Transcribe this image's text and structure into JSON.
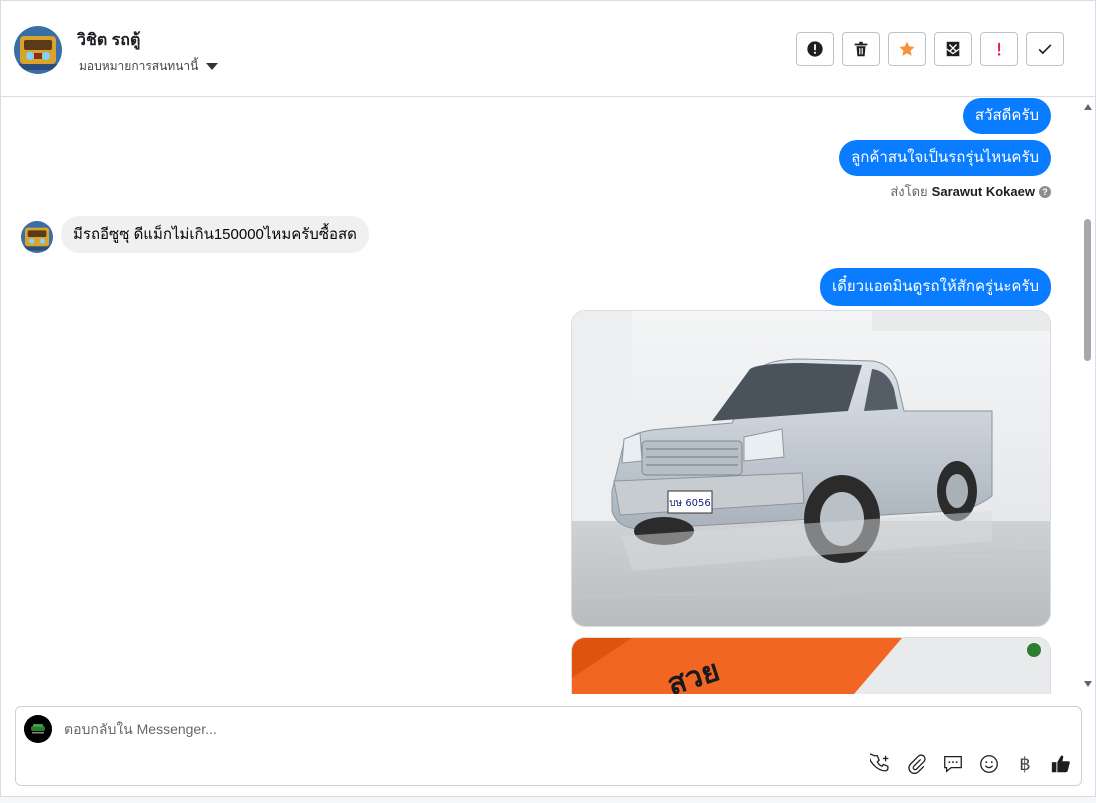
{
  "header": {
    "contact_name": "วิชิต รถตู้",
    "assign_label": "มอบหมายการสนทนานี้",
    "actions": [
      {
        "icon": "exclamation-circle-icon",
        "color": "#1c1e21"
      },
      {
        "icon": "trash-icon",
        "color": "#1c1e21"
      },
      {
        "icon": "star-icon",
        "color": "#f7923b"
      },
      {
        "icon": "mail-unread-icon",
        "color": "#1c1e21"
      },
      {
        "icon": "priority-icon",
        "color": "#e41e3f"
      },
      {
        "icon": "check-icon",
        "color": "#1c1e21"
      }
    ]
  },
  "messages": {
    "out_1": "สวัสดีครับ",
    "out_2": "ลูกค้าสนใจเป็นรถรุ่นไหนครับ",
    "sent_by_prefix": "ส่งโดย",
    "sent_by_name": "Sarawut Kokaew",
    "in_1": "มีรถอีซูซุ ดีแม็กไม่เกิน150000ไหมครับซื้อสด",
    "out_3": "เดี๋ยวแอดมินดูรถให้สักครู่นะครับ",
    "photo_1": {
      "plate": "บษ 6056",
      "subject": "silver pickup truck"
    },
    "photo_2": {
      "overlay_text": "สวย",
      "accent": "#f26522"
    }
  },
  "composer": {
    "placeholder": "ตอบกลับใน Messenger...",
    "value": "",
    "tools": [
      "phone-plus-icon",
      "attachment-icon",
      "saved-reply-icon",
      "emoji-icon",
      "baht-icon",
      "thumbs-up-icon"
    ],
    "baht_symbol": "฿"
  },
  "colors": {
    "outgoing_bubble": "#0a7cff",
    "incoming_bubble": "#f0f0f0",
    "border": "#dadde1"
  }
}
